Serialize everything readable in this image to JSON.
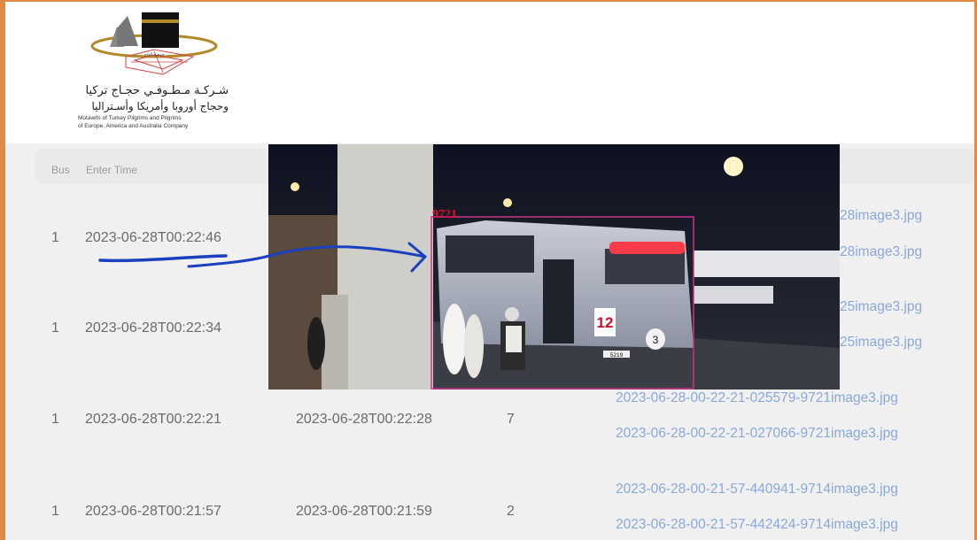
{
  "logo": {
    "small_arabic": "جمعية الحاج",
    "arabic_line1": "شـركـة مـطـوفـي حجـاج تركيا",
    "arabic_line2": "وحجاج أوروبا وأمريكا وأسـتراليا",
    "english_line1": "Motawifs of Turkey Pilgrims and Pilgrims",
    "english_line2": "of Europe, America and Australia Company"
  },
  "table": {
    "headers": {
      "bus": "Bus",
      "enter_time": "Enter Time"
    },
    "rows": [
      {
        "bus": "1",
        "enter_time": "2023-06-28T00:22:46",
        "exit_time": "",
        "count": "",
        "images": [
          "28image3.jpg",
          "28image3.jpg"
        ]
      },
      {
        "bus": "1",
        "enter_time": "2023-06-28T00:22:34",
        "exit_time": "",
        "count": "",
        "images": [
          "25image3.jpg",
          "25image3.jpg"
        ]
      },
      {
        "bus": "1",
        "enter_time": "2023-06-28T00:22:21",
        "exit_time": "2023-06-28T00:22:28",
        "count": "7",
        "images": [
          "2023-06-28-00-22-21-025579-9721image3.jpg",
          "2023-06-28-00-22-21-027066-9721image3.jpg"
        ]
      },
      {
        "bus": "1",
        "enter_time": "2023-06-28T00:21:57",
        "exit_time": "2023-06-28T00:21:59",
        "count": "2",
        "images": [
          "2023-06-28-00-21-57-440941-9714image3.jpg",
          "2023-06-28-00-21-57-442424-9714image3.jpg"
        ]
      }
    ]
  },
  "photo": {
    "detection_id": "9721",
    "bus_number": "12",
    "bus_small_number": "3",
    "plate": "5219"
  },
  "colors": {
    "accent_border": "#e08a45",
    "link": "#8aa8dc",
    "annotation_ink": "#1a3fbf",
    "detection_box": "#d0308a"
  }
}
